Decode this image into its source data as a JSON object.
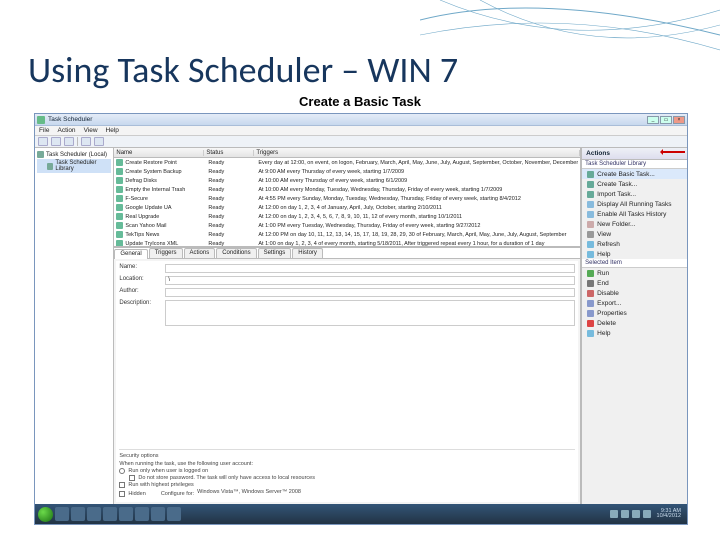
{
  "slide": {
    "title": "Using Task Scheduler – WIN 7",
    "subtitle": "Create a Basic Task"
  },
  "window": {
    "title": "Task Scheduler",
    "menus": [
      "File",
      "Action",
      "View",
      "Help"
    ]
  },
  "tree": {
    "root": "Task Scheduler (Local)",
    "child": "Task Scheduler Library"
  },
  "tasklist": {
    "headers": {
      "name": "Name",
      "status": "Status",
      "triggers": "Triggers"
    },
    "rows": [
      {
        "name": "Create Restore Point",
        "status": "Ready",
        "triggers": "Every day at 12:00, on event, on logon, February, March, April, May, June, July, August, September, October, November, December"
      },
      {
        "name": "Create System Backup",
        "status": "Ready",
        "triggers": "At 9:00 AM every Thursday of every week, starting 1/7/2009"
      },
      {
        "name": "Defrag Disks",
        "status": "Ready",
        "triggers": "At 10:00 AM every Thursday of every week, starting 6/1/2009"
      },
      {
        "name": "Empty the Internal Trash",
        "status": "Ready",
        "triggers": "At 10:00 AM every Monday, Tuesday, Wednesday, Thursday, Friday of every week, starting 1/7/2009"
      },
      {
        "name": "F-Secure",
        "status": "Ready",
        "triggers": "At 4:55 PM every Sunday, Monday, Tuesday, Wednesday, Thursday, Friday of every week, starting 8/4/2012"
      },
      {
        "name": "Google Update UA",
        "status": "Ready",
        "triggers": "At 12:00 on day 1, 2, 3, 4 of January, April, July, October, starting 2/10/2011"
      },
      {
        "name": "Real Upgrade",
        "status": "Ready",
        "triggers": "At 12:00 on day 1, 2, 3, 4, 5, 6, 7, 8, 9, 10, 11, 12 of every month, starting 10/1/2011"
      },
      {
        "name": "Scan Yahoo Mail",
        "status": "Ready",
        "triggers": "At 1:00 PM every Tuesday, Wednesday, Thursday, Friday of every week, starting 9/27/2012"
      },
      {
        "name": "TekTips News",
        "status": "Ready",
        "triggers": "At 12:00 PM on day 10, 11, 12, 13, 14, 15, 17, 18, 19, 28, 29, 30 of February, March, April, May, June, July, August, September"
      },
      {
        "name": "Update TryIcons XML",
        "status": "Ready",
        "triggers": "At 1:00 on day 1, 2, 3, 4 of every month, starting 5/18/2011, After triggered repeat every 1 hour, for a duration of 1 day"
      }
    ]
  },
  "tabs": [
    "General",
    "Triggers",
    "Actions",
    "Conditions",
    "Settings",
    "History"
  ],
  "detail": {
    "name_label": "Name:",
    "location_label": "Location:",
    "location_value": "\\",
    "author_label": "Author:",
    "desc_label": "Description:"
  },
  "security": {
    "heading": "Security options",
    "line1": "When running the task, use the following user account:",
    "opt1": "Run only when user is logged on",
    "opt2": "Do not store password. The task will only have access to local resources",
    "opt3": "Run with highest privileges",
    "hidden": "Hidden",
    "configure": "Configure for:",
    "configure_value": "Windows Vista™, Windows Server™ 2008"
  },
  "actions": {
    "header": "Actions",
    "section1": "Task Scheduler Library",
    "items1": [
      {
        "icon": "#6a9",
        "label": "Create Basic Task..."
      },
      {
        "icon": "#6a9",
        "label": "Create Task..."
      },
      {
        "icon": "#6a9",
        "label": "Import Task..."
      },
      {
        "icon": "#8bd",
        "label": "Display All Running Tasks"
      },
      {
        "icon": "#8bd",
        "label": "Enable All Tasks History"
      },
      {
        "icon": "#caa",
        "label": "New Folder..."
      },
      {
        "icon": "#999",
        "label": "View"
      },
      {
        "icon": "#7bd",
        "label": "Refresh"
      },
      {
        "icon": "#7bd",
        "label": "Help"
      }
    ],
    "section2": "Selected Item",
    "items2": [
      {
        "icon": "#5a5",
        "label": "Run"
      },
      {
        "icon": "#777",
        "label": "End"
      },
      {
        "icon": "#c66",
        "label": "Disable"
      },
      {
        "icon": "#89c",
        "label": "Export..."
      },
      {
        "icon": "#89c",
        "label": "Properties"
      },
      {
        "icon": "#d44",
        "label": "Delete"
      },
      {
        "icon": "#7bd",
        "label": "Help"
      }
    ]
  },
  "taskbar": {
    "time": "9:31 AM",
    "date": "10/4/2012"
  }
}
